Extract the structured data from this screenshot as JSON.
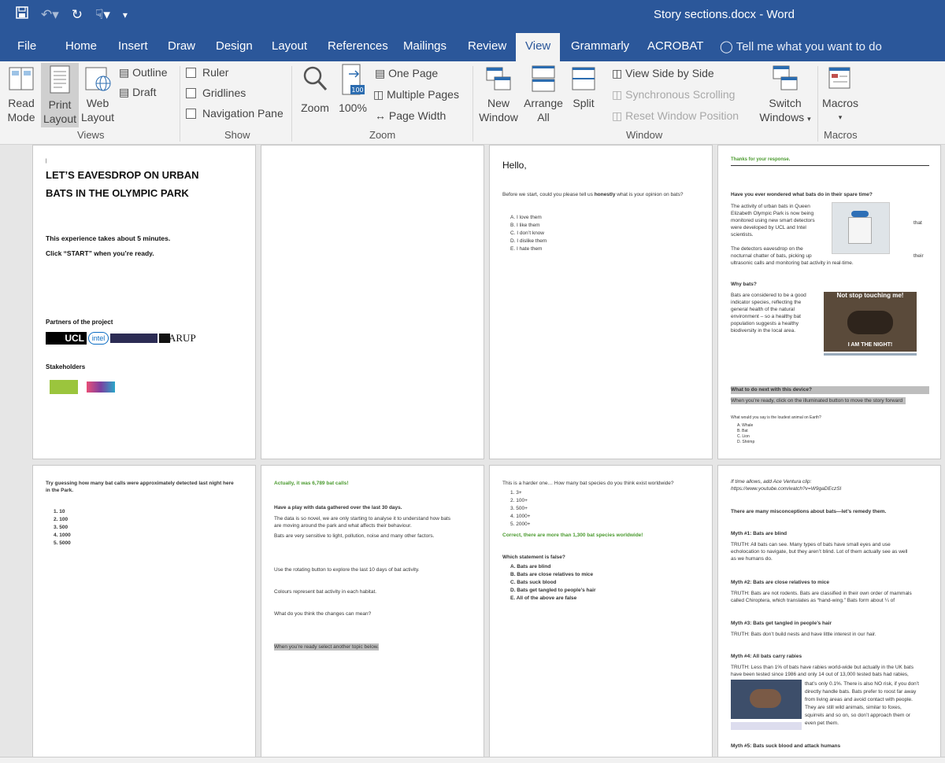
{
  "title": "Story sections.docx  -  Word",
  "tabs": [
    "File",
    "Home",
    "Insert",
    "Draw",
    "Design",
    "Layout",
    "References",
    "Mailings",
    "Review",
    "View",
    "Grammarly",
    "ACROBAT"
  ],
  "tell_me": "Tell me what you want to do",
  "ribbon": {
    "views": {
      "read": [
        "Read",
        "Mode"
      ],
      "print": [
        "Print",
        "Layout"
      ],
      "web": [
        "Web",
        "Layout"
      ],
      "outline": "Outline",
      "draft": "Draft",
      "group": "Views"
    },
    "show": {
      "ruler": "Ruler",
      "gridlines": "Gridlines",
      "nav": "Navigation Pane",
      "group": "Show"
    },
    "zoom": {
      "zoom": "Zoom",
      "pct": "100%",
      "one_page": "One Page",
      "multiple": "Multiple Pages",
      "width": "Page Width",
      "group": "Zoom"
    },
    "window": {
      "new": [
        "New",
        "Window"
      ],
      "arrange": [
        "Arrange",
        "All"
      ],
      "split": "Split",
      "side": "View Side by Side",
      "sync": "Synchronous Scrolling",
      "reset": "Reset Window Position",
      "switch": [
        "Switch",
        "Windows"
      ],
      "group": "Window"
    },
    "macros": {
      "label": "Macros",
      "group": "Macros"
    }
  },
  "pages": {
    "p1": {
      "title1": "LET’S EAVESDROP ON URBAN",
      "title2": "BATS IN THE OLYMPIC PARK",
      "l1": "This experience takes about 5 minutes.",
      "l2": "Click “START” when you’re ready.",
      "partners": "Partners of the project",
      "ucl": "UCL",
      "intel": "intel",
      "arup": "ARUP",
      "stake": "Stakeholders"
    },
    "p3": {
      "hello": "Hello,",
      "q_pre": "Before we start, could you please tell us ",
      "q_b": "honestly",
      "q_post": " what is your opinion on bats?",
      "opts": [
        "A.  I love them",
        "B.  I like them",
        "C.  I don’t know",
        "D.  I dislike them",
        "E.  I hate them"
      ]
    },
    "p4": {
      "thanks": "Thanks for your response.",
      "h1": "Have you ever wondered what bats do in their spare time?",
      "para1": [
        "The activity of urban bats in Queen",
        "Elizabeth Olympic Park is now being",
        "monitored using new smart detectors",
        "were developed by UCL and Intel",
        "scientists."
      ],
      "that": "that",
      "para2": [
        "The detectors eavesdrop on the",
        "nocturnal chatter of bats, picking up",
        "ultrasonic calls and monitoring bat activity in real-time."
      ],
      "their": "their",
      "h2": "Why bats?",
      "para3": [
        "Bats are considered to be a good",
        "indicator species, reflecting the",
        "general health of the natural",
        "environment – so a healthy bat",
        "population suggests a healthy",
        "biodiversity in the local area."
      ],
      "meme_top": "Not stop touching me!",
      "meme_bot": "I AM THE NIGHT!",
      "h3": "What to do next with this device?",
      "hl": "When you’re ready, click on the illuminated button to move the story forward",
      "q": "What would you say is the loudest animal on Earth?",
      "opts": [
        "A.   Whale",
        "B.   Bat",
        "C.   Lion",
        "D.   Shrimp"
      ]
    },
    "p5": {
      "q1": "Try guessing how many bat calls were approximately detected last night here",
      "q2": "in the Park.",
      "opts": [
        "1.  10",
        "2.  100",
        "3.  500",
        "4.  1000",
        "5.  5000"
      ]
    },
    "p6": {
      "ans": "Actually, it was 6,789 bat calls!",
      "h": "Have a play with data gathered over the last 30 days.",
      "l1": "The data is so novel, we are only starting to analyse it to understand how bats",
      "l2": "are moving around the park and what affects their behaviour.",
      "l3": "Bats are very sensitive to light, pollution, noise and many other factors.",
      "l4": "Use the rotating button to explore the last 10 days of bat activity.",
      "l5": "Colours represent bat activity in each habitat.",
      "l6": "What do you think the changes can mean?",
      "hl": "When you’re ready select another topic below."
    },
    "p7": {
      "q": "This is a harder one… How many bat species do you think exist worldwide?",
      "opts": [
        "1.  3+",
        "2.  100+",
        "3.  500+",
        "4.  1000+",
        "5.  2000+"
      ],
      "ans": "Correct, there are more than 1,300 bat species worldwide!",
      "h": "Which statement is false?",
      "opts2": [
        "A.  Bats are blind",
        "B.  Bats are close relatives to mice",
        "C.  Bats suck blood",
        "D.  Bats get tangled to people’s hair",
        "E.  All of the above are false"
      ]
    },
    "p8": {
      "it1": "If time allows, add Ace Ventura clip:",
      "it2": "https://www.youtube.com/watch?v=W9gaDEczSI",
      "h": "There are many misconceptions about bats—let’s remedy them.",
      "m1": "Myth #1: Bats are blind",
      "t1": [
        "TRUTH: All bats can see. Many types of bats have small eyes and use",
        "echolocation to navigate, but they aren’t blind. Lot of them actually see as well",
        "as we humans do."
      ],
      "m2": "Myth #2: Bats are close relatives to mice",
      "t2": [
        "TRUTH: Bats are not rodents. Bats are classified in their own order of mammals",
        "called Chiroptera, which translates as “hand-wing.” Bats form about ¼ of"
      ],
      "m3": "Myth #3: Bats get tangled in people’s hair",
      "t3": "TRUTH: Bats don’t build nests and have little interest in our hair.",
      "m4": "Myth #4: All bats carry rabies",
      "t4": [
        "TRUTH: Less than 1% of bats have rabies world-wide but actually in the UK bats",
        "have been tested since 1986 and only 14 out of 13,000 tested bats had rabies,"
      ],
      "t4b": [
        "that’s only 0.1%. There is also NO risk, if you don’t",
        "directly handle bats. Bats prefer to roost far away",
        "from living areas and avoid contact with people.",
        "They are still wild animals, similar to foxes,",
        "squirrels and so on, so don’t approach them or",
        "even pet them."
      ],
      "m5": "Myth #5: Bats suck blood and attack humans"
    }
  },
  "colors": {
    "accent": "#2b579a",
    "green": "#4a9a2e"
  }
}
